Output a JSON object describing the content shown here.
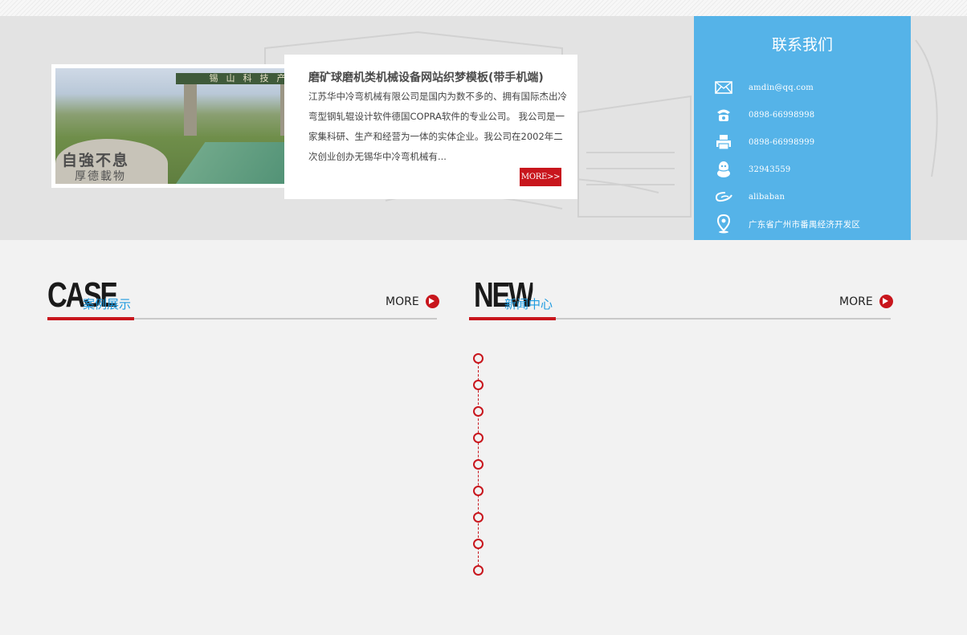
{
  "about": {
    "title": "磨矿球磨机类机械设备网站织梦模板(带手机端)",
    "description": "江苏华中冷弯机械有限公司是国内为数不多的、拥有国际杰出冷弯型钢轧辊设计软件德国COPRA软件的专业公司。 我公司是一家集科研、生产和经营为一体的实体企业。我公司在2002年二次创业创办无锡华中冷弯机械有...",
    "more_label": "MORE>>",
    "photo": {
      "gate_sign": "锡山科技产业园",
      "rock_line1": "自強不息",
      "rock_line2": "厚德載物"
    }
  },
  "contact": {
    "title": "联系我们",
    "items": [
      {
        "icon": "mail-icon",
        "text": "amdin@qq.com"
      },
      {
        "icon": "phone-icon",
        "text": "0898-66998998"
      },
      {
        "icon": "fax-icon",
        "text": "0898-66998999"
      },
      {
        "icon": "qq-icon",
        "text": "32943559"
      },
      {
        "icon": "alibaba-icon",
        "text": "alibaban"
      },
      {
        "icon": "location-icon",
        "text": "广东省广州市番禺经济开发区"
      }
    ]
  },
  "case_section": {
    "big_label": "CASE",
    "title": "案例展示",
    "more_label": "MORE"
  },
  "news_section": {
    "big_label": "NEW",
    "title": "新闻中心",
    "more_label": "MORE"
  },
  "colors": {
    "accent_red": "#c8161d",
    "accent_blue": "#1e9be0",
    "contact_bg": "#55b3e8"
  }
}
